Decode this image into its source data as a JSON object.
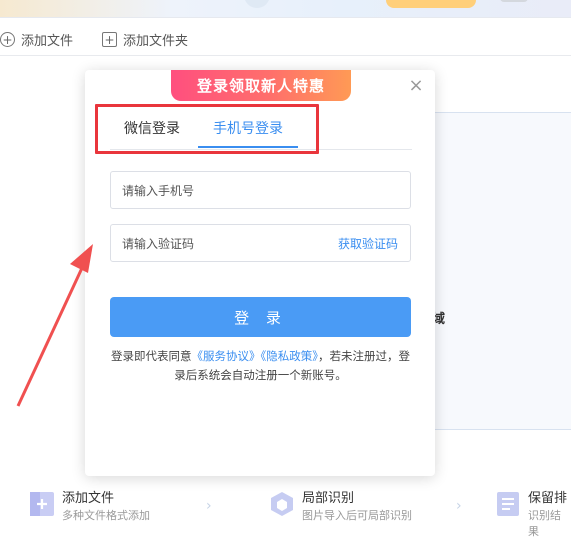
{
  "toolbar": {
    "add_file": "添加文件",
    "add_folder": "添加文件夹"
  },
  "background": {
    "drop_area_text": "域"
  },
  "features": [
    {
      "title": "添加文件",
      "desc": "多种文件格式添加"
    },
    {
      "title": "局部识别",
      "desc": "图片导入后可局部识别"
    },
    {
      "title": "保留排",
      "desc": "识别结果"
    }
  ],
  "login_modal": {
    "banner": "登录领取新人特惠",
    "tabs": [
      "微信登录",
      "手机号登录"
    ],
    "active_tab": "手机号登录",
    "phone_placeholder": "请输入手机号",
    "code_placeholder": "请输入验证码",
    "get_code": "获取验证码",
    "login_button": "登 录",
    "terms": {
      "prefix": "登录即代表同意",
      "service_agreement": "《服务协议》",
      "privacy_policy": "《隐私政策》",
      "suffix": "，若未注册过，登录后系统会自动注册一个新账号。"
    }
  },
  "colors": {
    "accent_blue": "#3a8ef0",
    "button_blue": "#4a9bf5",
    "annotation_red": "#e9353c"
  }
}
